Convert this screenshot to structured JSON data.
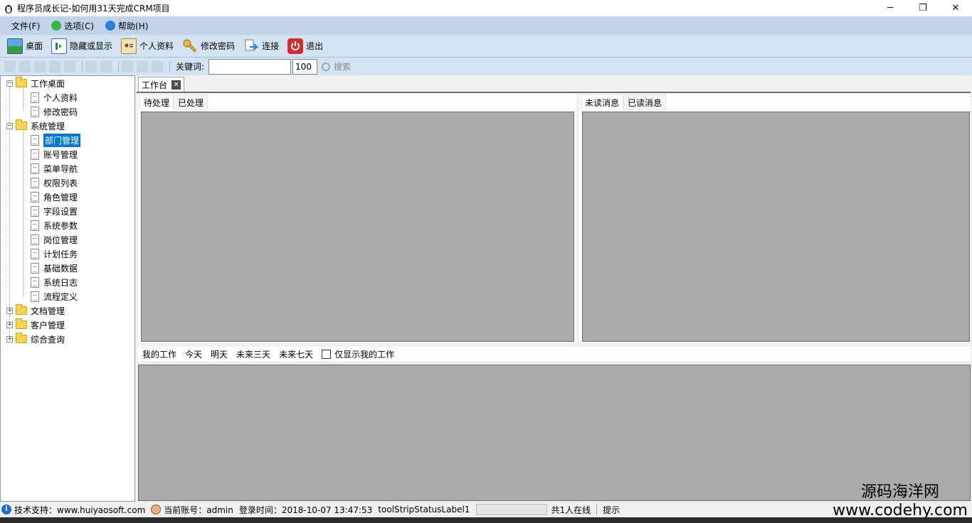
{
  "window": {
    "title": "程序员成长记-如何用31天完成CRM项目",
    "minimize_glyph": "─",
    "restore_glyph": "❐",
    "close_glyph": "✕"
  },
  "menu": [
    {
      "label": "文件(F)",
      "icon": "",
      "color": ""
    },
    {
      "label": "选项(C)",
      "icon": "options-icon",
      "color": "#3bb34a"
    },
    {
      "label": "帮助(H)",
      "icon": "help-icon",
      "color": "#2a7fd4"
    }
  ],
  "toolbar": {
    "desktop": "桌面",
    "toggle": "隐藏或显示",
    "profile": "个人资料",
    "change_password": "修改密码",
    "connect": "连接",
    "exit": "退出"
  },
  "filter": {
    "keyword_label": "关键词:",
    "keyword_value": "",
    "count_value": "100",
    "search_label": "搜索"
  },
  "tree": {
    "group1": "工作桌面",
    "g1_items": [
      "个人资料",
      "修改密码"
    ],
    "group2": "系统管理",
    "g2_items": [
      "部门管理",
      "账号管理",
      "菜单导航",
      "权限列表",
      "角色管理",
      "字段设置",
      "系统参数",
      "岗位管理",
      "计划任务",
      "基础数据",
      "系统日志",
      "流程定义"
    ],
    "group3": "文档管理",
    "group4": "客户管理",
    "group5": "综合查询",
    "expand_minus": "−",
    "expand_plus": "+"
  },
  "main": {
    "tab_label": "工作台",
    "tab_close": "✕",
    "left_tabs": [
      "待处理",
      "已处理"
    ],
    "right_tabs": [
      "未读消息",
      "已读消息"
    ],
    "work_tabs": [
      "我的工作",
      "今天",
      "明天",
      "未来三天",
      "未来七天"
    ],
    "only_mine_label": "仅显示我的工作"
  },
  "status": {
    "support": "技术支持：www.huiyaosoft.com",
    "account": "当前账号：admin",
    "login_time": "登录时间：2018-10-07 13:47:53",
    "label1": "toolStripStatusLabel1",
    "online": "共1人在线",
    "hint": "提示"
  },
  "watermark": {
    "line1": "源码海洋网",
    "line2": "www.codehy.com"
  }
}
